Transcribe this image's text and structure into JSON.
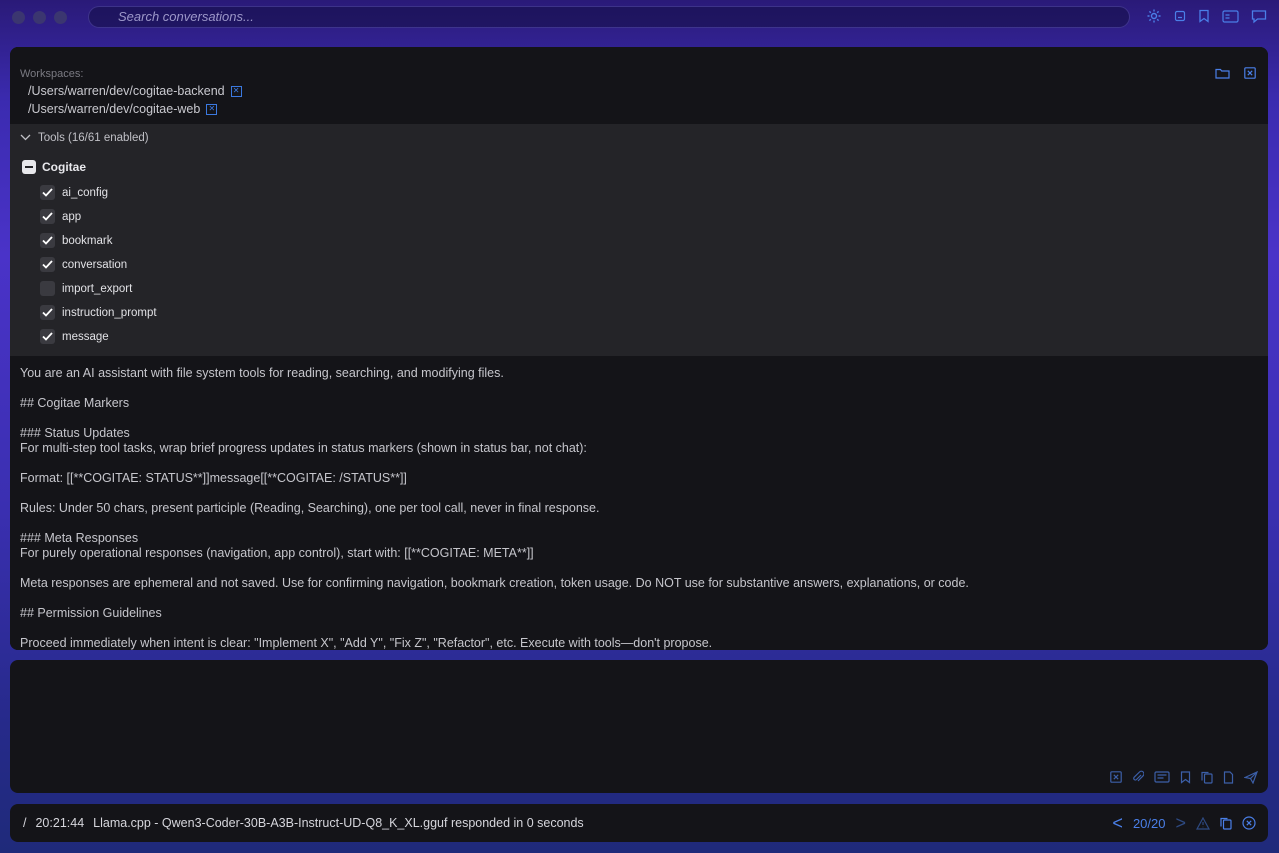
{
  "search": {
    "placeholder": "Search conversations..."
  },
  "topbar": {
    "icons": [
      "settings-icon",
      "minimize-icon",
      "bookmark-icon",
      "sidebar-icon",
      "chat-icon"
    ]
  },
  "workspaces": {
    "label": "Workspaces:",
    "paths": [
      "/Users/warren/dev/cogitae-backend",
      "/Users/warren/dev/cogitae-web"
    ]
  },
  "tools": {
    "header": "Tools (16/61 enabled)",
    "group_name": "Cogitae",
    "items": [
      {
        "label": "ai_config",
        "checked": true
      },
      {
        "label": "app",
        "checked": true
      },
      {
        "label": "bookmark",
        "checked": true
      },
      {
        "label": "conversation",
        "checked": true
      },
      {
        "label": "import_export",
        "checked": false
      },
      {
        "label": "instruction_prompt",
        "checked": true
      },
      {
        "label": "message",
        "checked": true
      }
    ]
  },
  "prompt": {
    "lines": [
      "You are an AI assistant with file system tools for reading, searching, and modifying files.",
      "## Cogitae Markers",
      "### Status Updates\nFor multi-step tool tasks, wrap brief progress updates in status markers (shown in status bar, not chat):",
      "Format: [[**COGITAE: STATUS**]]message[[**COGITAE: /STATUS**]]",
      "Rules: Under 50 chars, present participle (Reading, Searching), one per tool call, never in final response.",
      "### Meta Responses\nFor purely operational responses (navigation, app control), start with: [[**COGITAE: META**]]",
      "Meta responses are ephemeral and not saved. Use for confirming navigation, bookmark creation, token usage. Do NOT use for substantive answers, explanations, or code.",
      "## Permission Guidelines",
      "Proceed immediately when intent is clear: \"Implement X\", \"Add Y\", \"Fix Z\", \"Refactor\", etc. Execute with tools—don't propose."
    ]
  },
  "status": {
    "slash": "/",
    "time": "20:21:44",
    "message": "Llama.cpp - Qwen3-Coder-30B-A3B-Instruct-UD-Q8_K_XL.gguf responded in 0 seconds",
    "page": "20/20"
  },
  "colors": {
    "accent": "#4a7fe8",
    "panel_bg": "#141418",
    "tools_bg": "#242428"
  }
}
